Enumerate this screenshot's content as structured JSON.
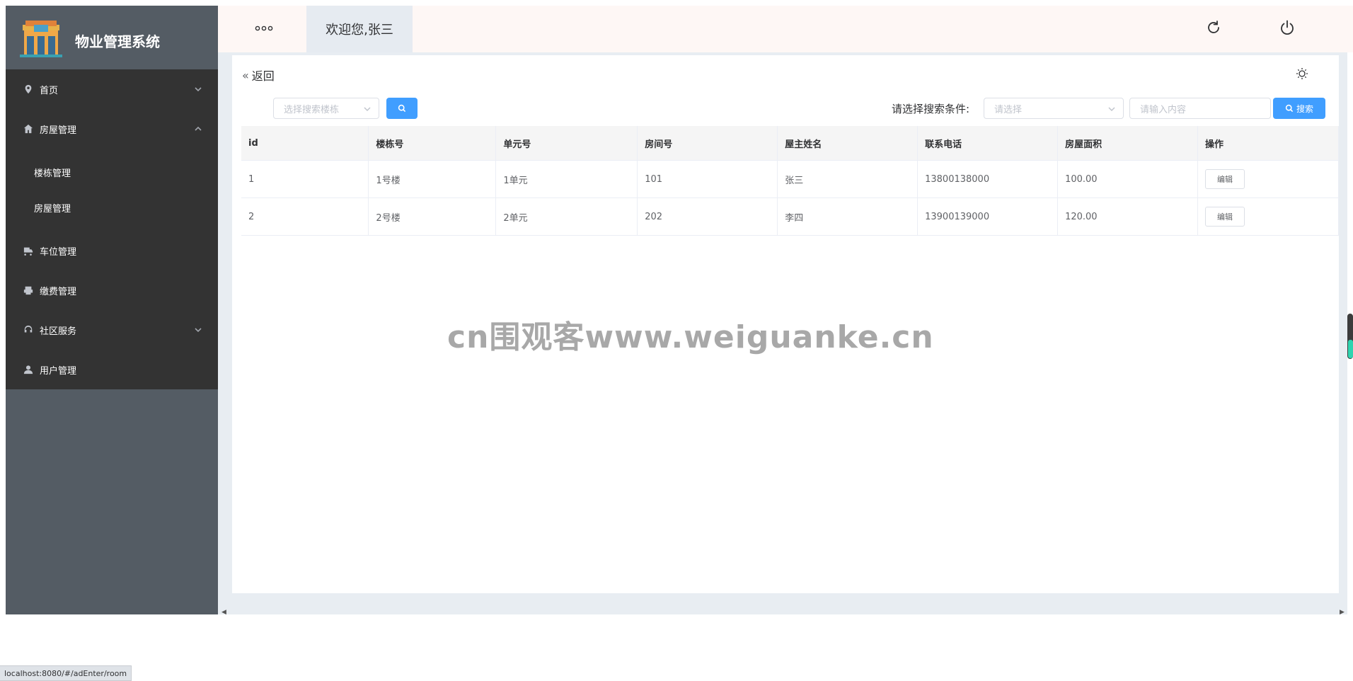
{
  "sidebar": {
    "app_title": "物业管理系统",
    "items": [
      {
        "label": "首页",
        "icon": "location-icon"
      },
      {
        "label": "房屋管理",
        "icon": "home-icon",
        "expanded": true,
        "children": [
          {
            "label": "楼栋管理"
          },
          {
            "label": "房屋管理"
          }
        ]
      },
      {
        "label": "车位管理",
        "icon": "truck-icon"
      },
      {
        "label": "缴费管理",
        "icon": "printer-icon"
      },
      {
        "label": "社区服务",
        "icon": "headset-icon"
      },
      {
        "label": "用户管理",
        "icon": "user-icon"
      }
    ]
  },
  "header": {
    "welcome": "欢迎您,张三",
    "icons": [
      "more-icon",
      "refresh-icon",
      "power-icon"
    ]
  },
  "toolbar": {
    "back_label": "返回",
    "building_placeholder": "选择搜索楼栋",
    "condition_label": "请选择搜索条件:",
    "condition_placeholder": "请选择",
    "keyword_placeholder": "请输入内容",
    "search_label": "搜索"
  },
  "table": {
    "columns": [
      "id",
      "楼栋号",
      "单元号",
      "房间号",
      "屋主姓名",
      "联系电话",
      "房屋面积",
      "操作"
    ],
    "rows": [
      {
        "id": "1",
        "building": "1号楼",
        "unit": "1单元",
        "room": "101",
        "owner": "张三",
        "phone": "13800138000",
        "area": "100.00",
        "action": "编辑"
      },
      {
        "id": "2",
        "building": "2号楼",
        "unit": "2单元",
        "room": "202",
        "owner": "李四",
        "phone": "13900139000",
        "area": "120.00",
        "action": "编辑"
      }
    ]
  },
  "watermark": "cn围观客www.weiguanke.cn",
  "status_url": "localhost:8080/#/adEnter/room",
  "colors": {
    "sidebar_bg": "#545c64",
    "menu_bg": "#333333",
    "header_bg": "#fef7f5",
    "primary": "#409eff",
    "content_bg": "#e8edf2"
  }
}
